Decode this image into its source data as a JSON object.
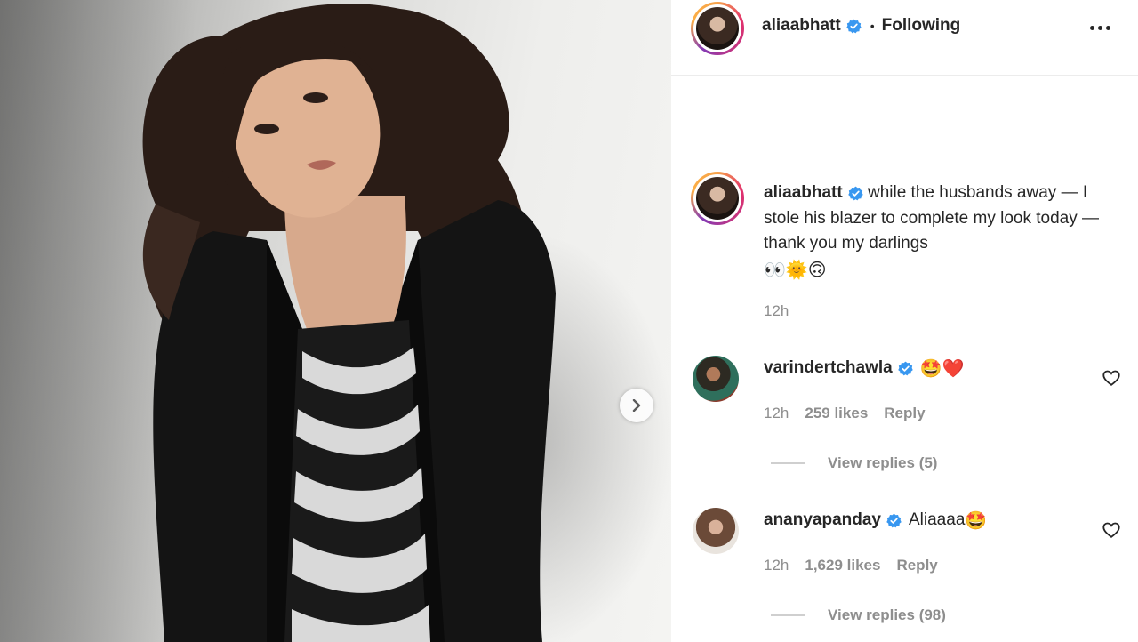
{
  "post": {
    "author": "aliaabhatt",
    "follow_status": "Following",
    "separator": "•",
    "caption_text": "while the husbands away — I stole his blazer to complete my look today — thank you my darlings",
    "caption_emojis": "👀🌞🙃",
    "caption_time": "12h"
  },
  "comments": [
    {
      "username": "varindertchawla",
      "text": "",
      "emojis": "🤩❤️",
      "time": "12h",
      "likes": "259 likes",
      "reply_label": "Reply",
      "view_replies": "View replies (5)"
    },
    {
      "username": "ananyapanday",
      "text": "Aliaaaa",
      "emojis": "🤩",
      "time": "12h",
      "likes": "1,629 likes",
      "reply_label": "Reply",
      "view_replies": "View replies (98)"
    }
  ],
  "icons": {
    "verified": "verified-badge-icon",
    "next": "chevron-right-icon",
    "more": "more-options-icon",
    "like": "heart-outline-icon"
  },
  "colors": {
    "verified_blue": "#3897f0",
    "meta_gray": "#8e8e8e",
    "text": "#262626"
  }
}
